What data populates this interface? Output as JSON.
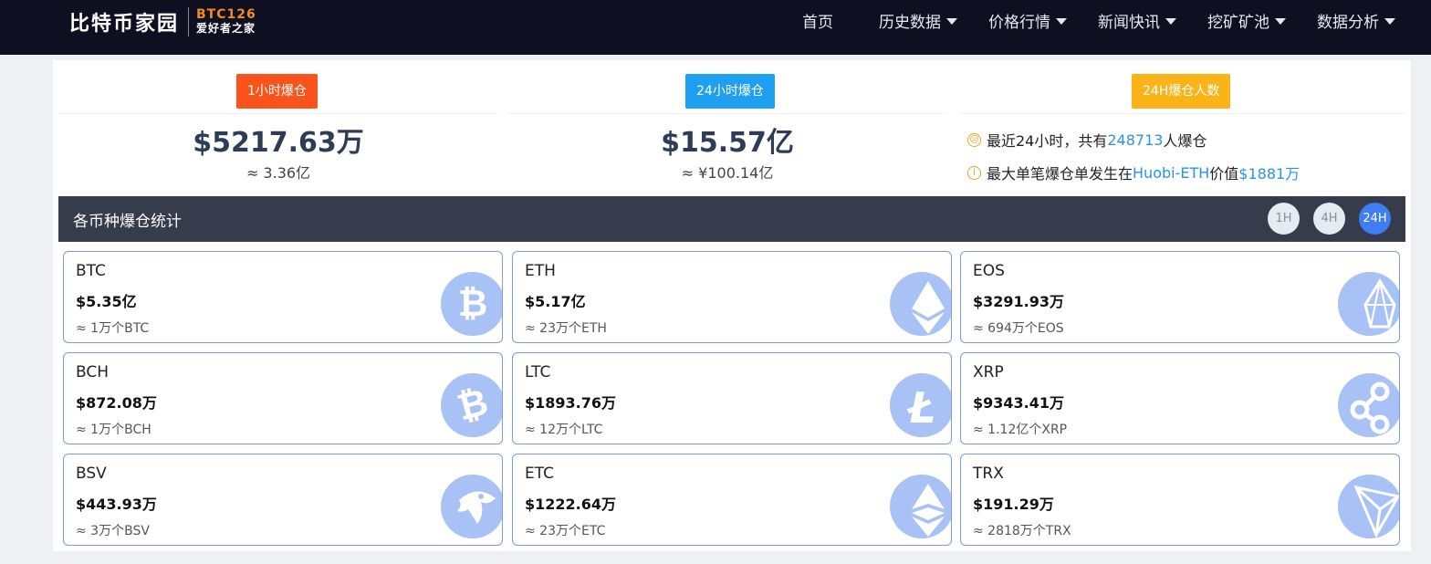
{
  "header": {
    "logo_text": "比特币家园",
    "logo_code": "BTC126",
    "logo_tagline": "爱好者之家",
    "nav": [
      {
        "label": "首页",
        "dropdown": false
      },
      {
        "label": "历史数据",
        "dropdown": true
      },
      {
        "label": "价格行情",
        "dropdown": true
      },
      {
        "label": "新闻快讯",
        "dropdown": true
      },
      {
        "label": "挖矿矿池",
        "dropdown": true
      },
      {
        "label": "数据分析",
        "dropdown": true
      }
    ]
  },
  "summary": {
    "hour1": {
      "label": "1小时爆仓",
      "value": "$5217.63万",
      "approx": "≈ 3.36亿",
      "color": "#fa541c"
    },
    "hour24": {
      "label": "24小时爆仓",
      "value": "$15.57亿",
      "approx": "≈ ¥100.14亿",
      "color": "#1e9ff2"
    },
    "people": {
      "label": "24H爆仓人数",
      "color": "#fbb418",
      "line1_prefix": "最近24小时，共有",
      "line1_count": "248713",
      "line1_suffix": "人爆仓",
      "line2_prefix": "最大单笔爆仓单发生在",
      "line2_exchange": "Huobi-ETH",
      "line2_mid": "价值",
      "line2_value": "$1881万"
    }
  },
  "section": {
    "title": "各币种爆仓统计",
    "timeframes": [
      "1H",
      "4H",
      "24H"
    ],
    "active_timeframe": "24H"
  },
  "coins": [
    {
      "symbol": "BTC",
      "value": "$5.35亿",
      "approx": "≈ 1万个BTC",
      "icon": "bitcoin-icon"
    },
    {
      "symbol": "ETH",
      "value": "$5.17亿",
      "approx": "≈ 23万个ETH",
      "icon": "ethereum-icon"
    },
    {
      "symbol": "EOS",
      "value": "$3291.93万",
      "approx": "≈ 694万个EOS",
      "icon": "eos-icon"
    },
    {
      "symbol": "BCH",
      "value": "$872.08万",
      "approx": "≈ 1万个BCH",
      "icon": "bitcoin-cash-icon"
    },
    {
      "symbol": "LTC",
      "value": "$1893.76万",
      "approx": "≈ 12万个LTC",
      "icon": "litecoin-icon"
    },
    {
      "symbol": "XRP",
      "value": "$9343.41万",
      "approx": "≈ 1.12亿个XRP",
      "icon": "ripple-icon"
    },
    {
      "symbol": "BSV",
      "value": "$443.93万",
      "approx": "≈ 3万个BSV",
      "icon": "bsv-icon"
    },
    {
      "symbol": "ETC",
      "value": "$1222.64万",
      "approx": "≈ 23万个ETC",
      "icon": "ethereum-classic-icon"
    },
    {
      "symbol": "TRX",
      "value": "$191.29万",
      "approx": "≈ 2818万个TRX",
      "icon": "tron-icon"
    }
  ]
}
